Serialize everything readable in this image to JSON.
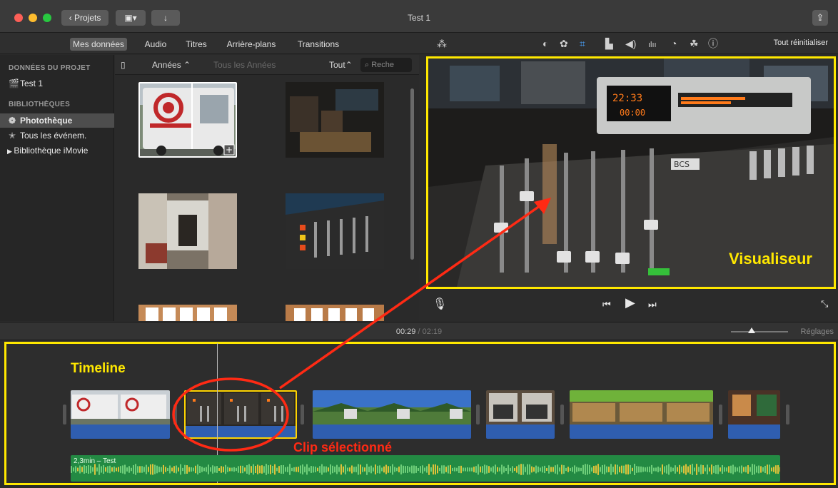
{
  "window": {
    "title": "Test 1"
  },
  "toolbar": {
    "projects_label": "Projets",
    "share_icon": "share-icon"
  },
  "media_tabs": [
    {
      "label": "Mes données",
      "active": true
    },
    {
      "label": "Audio"
    },
    {
      "label": "Titres"
    },
    {
      "label": "Arrière-plans"
    },
    {
      "label": "Transitions"
    }
  ],
  "adjust": {
    "reset_label": "Tout réinitialiser"
  },
  "sidebar": {
    "project_heading": "DONNÉES DU PROJET",
    "project_item": "Test 1",
    "libraries_heading": "BIBLIOTHÈQUES",
    "items": [
      {
        "label": "Photothèque",
        "selected": true
      },
      {
        "label": "Tous les événem."
      },
      {
        "label": "Bibliothèque iMovie"
      }
    ]
  },
  "browser": {
    "filter_years": "Années",
    "filter_all_years": "Tous les Années",
    "filter_all": "Tout",
    "search_placeholder": "Reche"
  },
  "viewer": {
    "annotation": "Visualiseur"
  },
  "timebar": {
    "current": "00:29",
    "separator": "/",
    "total": "02:19",
    "settings_label": "Réglages"
  },
  "timeline": {
    "annotation": "Timeline",
    "selected_annotation": "Clip sélectionné",
    "audio_label": "2,3min – Test"
  },
  "colors": {
    "annotation_yellow": "#ffe800",
    "annotation_red": "#ff2a14",
    "clip_blue": "#2f5eb0",
    "audio_green": "#238a43"
  }
}
